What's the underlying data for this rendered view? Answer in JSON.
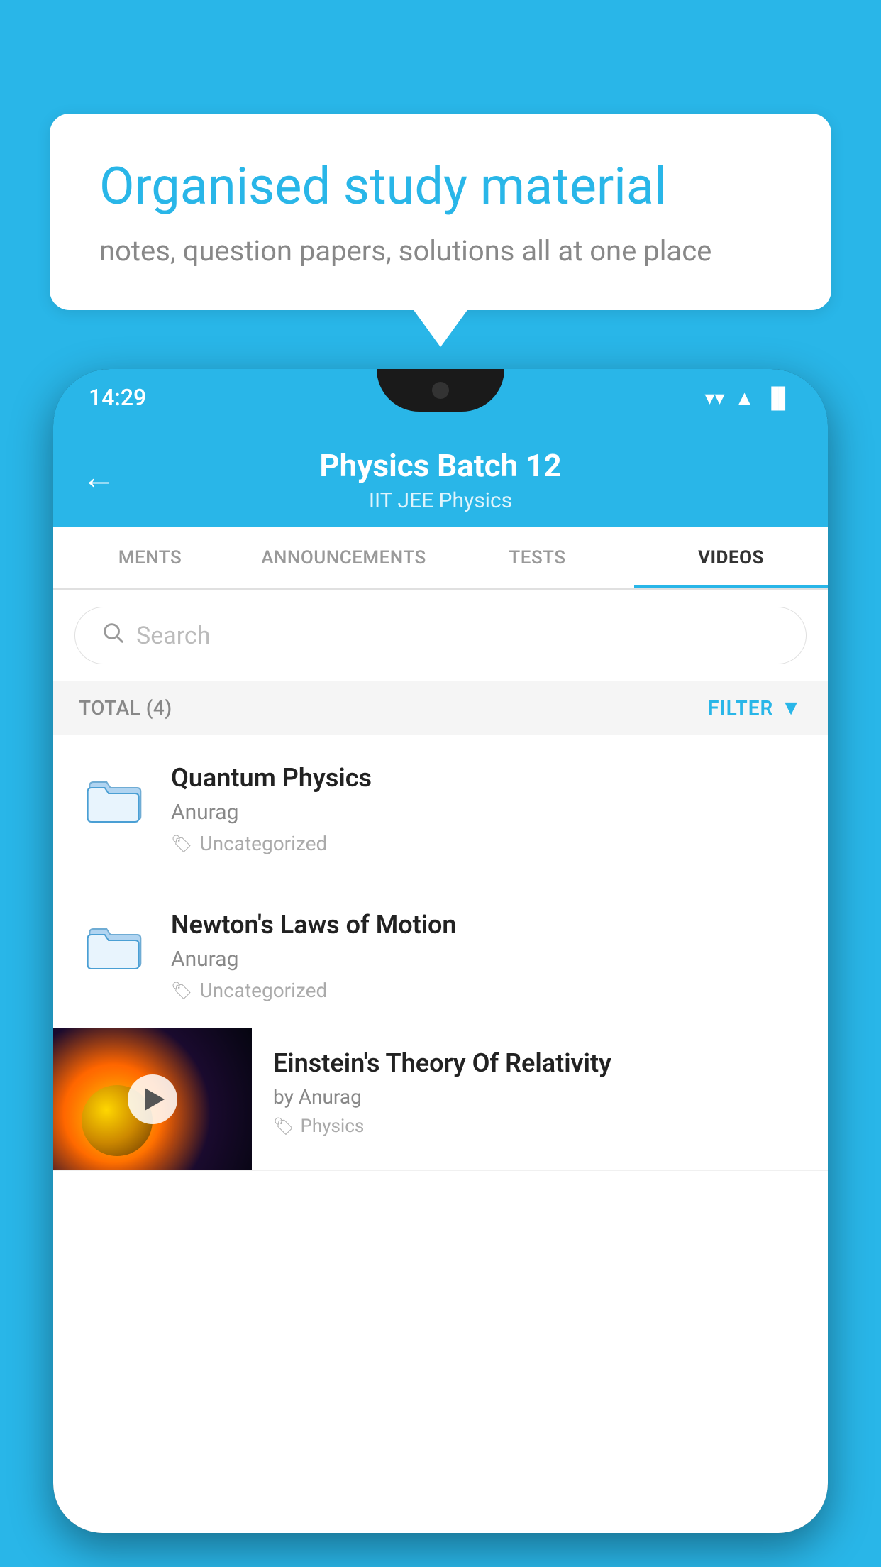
{
  "background_color": "#29b6e8",
  "speech_bubble": {
    "title": "Organised study material",
    "subtitle": "notes, question papers, solutions all at one place"
  },
  "phone": {
    "status_bar": {
      "time": "14:29",
      "wifi": "▼",
      "signal": "▲",
      "battery": "▐"
    },
    "header": {
      "title": "Physics Batch 12",
      "subtitle": "IIT JEE   Physics",
      "back_label": "←"
    },
    "tabs": [
      {
        "label": "MENTS",
        "active": false
      },
      {
        "label": "ANNOUNCEMENTS",
        "active": false
      },
      {
        "label": "TESTS",
        "active": false
      },
      {
        "label": "VIDEOS",
        "active": true
      }
    ],
    "search_placeholder": "Search",
    "filter": {
      "total_label": "TOTAL (4)",
      "filter_label": "FILTER"
    },
    "videos": [
      {
        "title": "Quantum Physics",
        "author": "Anurag",
        "tag": "Uncategorized",
        "has_thumb": false
      },
      {
        "title": "Newton's Laws of Motion",
        "author": "Anurag",
        "tag": "Uncategorized",
        "has_thumb": false
      },
      {
        "title": "Einstein's Theory Of Relativity",
        "author": "by Anurag",
        "tag": "Physics",
        "has_thumb": true
      }
    ]
  }
}
